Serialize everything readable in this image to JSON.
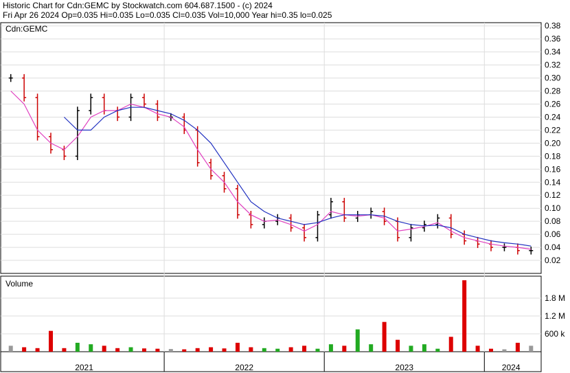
{
  "header": {
    "line1": "Historic Chart for Cdn:GEMC by Stockwatch.com 604.687.1500 - (c) 2024",
    "line2": "Fri Apr 26 2024   Op=0.035   Hi=0.035   Lo=0.035   Cl=0.035   Vol=10,000   Year hi=0.35   lo=0.025"
  },
  "colors": {
    "up_candle": "#000000",
    "down_candle": "#cc0000",
    "ma_short": "#e040c0",
    "ma_long": "#2030c0",
    "vol_up": "#22aa22",
    "vol_down": "#dd0000",
    "vol_neutral": "#999999",
    "grid": "#dddddd"
  },
  "chart_data": [
    {
      "type": "line",
      "title": "Cdn:GEMC",
      "x": [
        "2021-01",
        "2021-02",
        "2021-03",
        "2021-04",
        "2021-05",
        "2021-06",
        "2021-07",
        "2021-08",
        "2021-09",
        "2021-10",
        "2021-11",
        "2021-12",
        "2022-01",
        "2022-02",
        "2022-03",
        "2022-04",
        "2022-05",
        "2022-06",
        "2022-07",
        "2022-08",
        "2022-09",
        "2022-10",
        "2022-11",
        "2022-12",
        "2023-01",
        "2023-02",
        "2023-03",
        "2023-04",
        "2023-05",
        "2023-06",
        "2023-07",
        "2023-08",
        "2023-09",
        "2023-10",
        "2023-11",
        "2023-12",
        "2024-01",
        "2024-02",
        "2024-03",
        "2024-04"
      ],
      "series": [
        {
          "values": [
            0.3,
            0.27,
            0.21,
            0.19,
            0.18,
            0.25,
            0.27,
            0.25,
            0.24,
            0.27,
            0.26,
            0.24,
            0.24,
            0.22,
            0.17,
            0.15,
            0.13,
            0.09,
            0.075,
            0.08,
            0.085,
            0.07,
            0.055,
            0.09,
            0.11,
            0.085,
            0.09,
            0.095,
            0.08,
            0.055,
            0.07,
            0.075,
            0.085,
            0.06,
            0.05,
            0.045,
            0.04,
            0.04,
            0.035,
            0.035
          ]
        },
        {
          "values": [
            0.28,
            0.26,
            0.22,
            0.2,
            0.19,
            0.21,
            0.24,
            0.25,
            0.25,
            0.26,
            0.255,
            0.245,
            0.24,
            0.225,
            0.19,
            0.16,
            0.14,
            0.11,
            0.09,
            0.08,
            0.082,
            0.075,
            0.065,
            0.075,
            0.095,
            0.09,
            0.088,
            0.09,
            0.085,
            0.065,
            0.068,
            0.072,
            0.078,
            0.065,
            0.055,
            0.05,
            0.045,
            0.042,
            0.04,
            0.037
          ]
        },
        {
          "values": [
            null,
            null,
            null,
            null,
            0.24,
            0.22,
            0.22,
            0.24,
            0.25,
            0.255,
            0.255,
            0.25,
            0.245,
            0.235,
            0.22,
            0.2,
            0.17,
            0.14,
            0.11,
            0.095,
            0.085,
            0.08,
            0.075,
            0.078,
            0.085,
            0.09,
            0.09,
            0.09,
            0.088,
            0.08,
            0.075,
            0.073,
            0.074,
            0.07,
            0.06,
            0.055,
            0.05,
            0.047,
            0.045,
            0.042
          ]
        }
      ],
      "yticks": [
        "0.38",
        "0.36",
        "0.34",
        "0.32",
        "0.30",
        "0.28",
        "0.26",
        "0.24",
        "0.22",
        "0.20",
        "0.18",
        "0.16",
        "0.14",
        "0.12",
        "0.10",
        "0.08",
        "0.06",
        "0.04",
        "0.02"
      ],
      "ylim": [
        0.0,
        0.385
      ],
      "grid": true
    },
    {
      "type": "bar",
      "title": "Volume",
      "x": [
        "2021-01",
        "2021-02",
        "2021-03",
        "2021-04",
        "2021-05",
        "2021-06",
        "2021-07",
        "2021-08",
        "2021-09",
        "2021-10",
        "2021-11",
        "2021-12",
        "2022-01",
        "2022-02",
        "2022-03",
        "2022-04",
        "2022-05",
        "2022-06",
        "2022-07",
        "2022-08",
        "2022-09",
        "2022-10",
        "2022-11",
        "2022-12",
        "2023-01",
        "2023-02",
        "2023-03",
        "2023-04",
        "2023-05",
        "2023-06",
        "2023-07",
        "2023-08",
        "2023-09",
        "2023-10",
        "2023-11",
        "2023-12",
        "2024-01",
        "2024-02",
        "2024-03",
        "2024-04"
      ],
      "values": [
        200000,
        150000,
        120000,
        700000,
        120000,
        300000,
        250000,
        200000,
        120000,
        150000,
        110000,
        100000,
        90000,
        80000,
        120000,
        150000,
        110000,
        300000,
        150000,
        120000,
        100000,
        150000,
        200000,
        100000,
        250000,
        200000,
        750000,
        250000,
        1000000,
        400000,
        200000,
        250000,
        100000,
        500000,
        2400000,
        200000,
        100000,
        80000,
        300000,
        200000
      ],
      "yticks": [
        "1.8 M",
        "1.2 M",
        "600 k"
      ],
      "ylim": [
        0,
        2400000
      ],
      "grid": true
    }
  ],
  "x_axis": {
    "labels": [
      "2021",
      "2022",
      "2023",
      "2024"
    ],
    "dividers": [
      false,
      true,
      true,
      true
    ]
  }
}
